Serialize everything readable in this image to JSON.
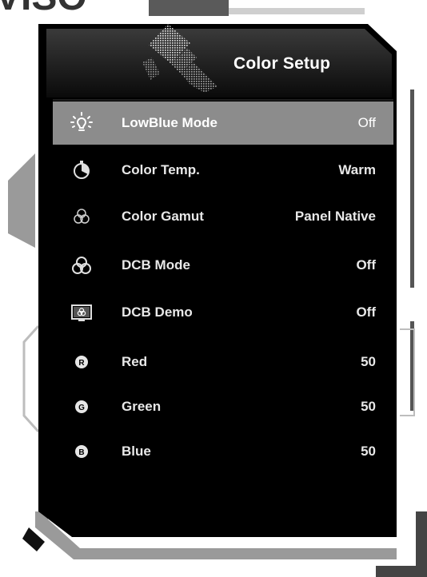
{
  "header": {
    "title": "Color Setup",
    "brand_fragment": "VISO",
    "icon": "paint-roller-icon"
  },
  "menu": {
    "items": [
      {
        "name": "lowblue-mode",
        "label": "LowBlue Mode",
        "value": "Off",
        "icon": "light-bulb-icon",
        "selected": true
      },
      {
        "name": "color-temp",
        "label": "Color Temp.",
        "value": "Warm",
        "icon": "thermometer-dial-icon",
        "selected": false
      },
      {
        "name": "color-gamut",
        "label": "Color Gamut",
        "value": "Panel Native",
        "icon": "three-circles-icon",
        "selected": false
      },
      {
        "name": "dcb-mode",
        "label": "DCB Mode",
        "value": "Off",
        "icon": "rgb-circles-icon",
        "selected": false
      },
      {
        "name": "dcb-demo",
        "label": "DCB Demo",
        "value": "Off",
        "icon": "monitor-demo-icon",
        "selected": false
      },
      {
        "name": "red",
        "label": "Red",
        "value": "50",
        "icon": "red-r-circle-icon",
        "selected": false
      },
      {
        "name": "green",
        "label": "Green",
        "value": "50",
        "icon": "green-g-circle-icon",
        "selected": false
      },
      {
        "name": "blue",
        "label": "Blue",
        "value": "50",
        "icon": "blue-b-circle-icon",
        "selected": false
      }
    ]
  },
  "colors": {
    "panel_bg": "#000000",
    "selected_bg": "#8c8c8c",
    "frame_gray": "#9a9a9a",
    "text": "#e8e8e8"
  }
}
